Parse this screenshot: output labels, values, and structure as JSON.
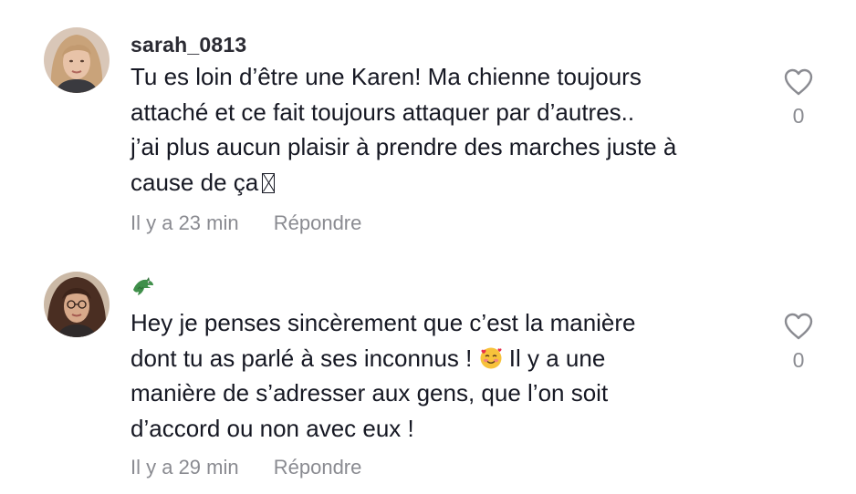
{
  "comments": [
    {
      "username": "sarah_0813",
      "avatar": "user-avatar-blonde",
      "text_line1": "Tu es loin d’être une Karen! Ma chienne toujours",
      "text_line2": "attaché et ce fait toujours attaquer par d’autres..",
      "text_line3": "j’ai plus aucun plaisir à prendre des marches juste à",
      "text_line4": "cause de ça",
      "trailing_glyph": "missing-emoji-glyph",
      "time": "Il y a 23 min",
      "reply_label": "Répondre",
      "likes": "0"
    },
    {
      "username_icon": "crocodile-emoji",
      "avatar": "user-avatar-curly-hair",
      "text_line1": "Hey je penses sincèrement que c’est la manière",
      "text_line2a": "dont tu as parlé à ses inconnus ! ",
      "text_emoji": "smiling-face-with-hearts-emoji",
      "text_line2b": " Il y a une",
      "text_line3": "manière de s’adresser aux gens, que l’on soit",
      "text_line4": "d’accord ou non avec eux !",
      "time": "Il y a 29 min",
      "reply_label": "Répondre",
      "likes": "0"
    }
  ],
  "colors": {
    "text": "#161823",
    "secondary": "#8a8b91",
    "heart_outline": "#8a8b91"
  }
}
